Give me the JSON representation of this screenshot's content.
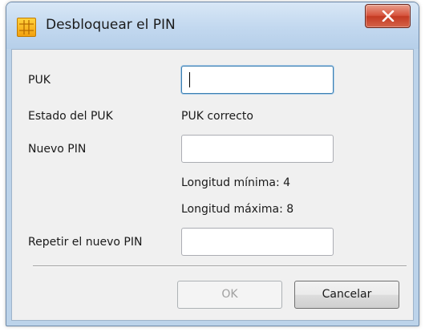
{
  "window": {
    "title": "Desbloquear el PIN",
    "close_symbol": "X"
  },
  "form": {
    "puk_label": "PUK",
    "puk_value": "",
    "puk_status_label": "Estado del  PUK",
    "puk_status_value": "PUK correcto",
    "new_pin_label": "Nuevo PIN",
    "new_pin_value": "",
    "min_length": "Longitud mínima: 4",
    "max_length": "Longitud máxima: 8",
    "repeat_pin_label": "Repetir el nuevo PIN",
    "repeat_pin_value": ""
  },
  "buttons": {
    "ok_label": "OK",
    "ok_enabled": false,
    "cancel_label": "Cancelar"
  },
  "icons": {
    "app": "smartcard-chip-icon",
    "close": "close-icon"
  }
}
